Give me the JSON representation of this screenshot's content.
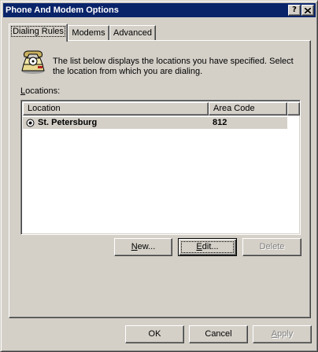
{
  "window": {
    "title": "Phone And Modem Options"
  },
  "title_buttons": {
    "help": "?",
    "close": "X"
  },
  "tabs": [
    {
      "label": "Dialing Rules",
      "active": true
    },
    {
      "label": "Modems",
      "active": false
    },
    {
      "label": "Advanced",
      "active": false
    }
  ],
  "dialing_rules": {
    "icon": "telephone-icon",
    "description": "The list below displays the locations you have specified. Select the location from which you are dialing.",
    "locations_label": "Locations:",
    "columns": [
      "Location",
      "Area Code"
    ],
    "rows": [
      {
        "location": "St. Petersburg",
        "area_code": "812",
        "selected": true
      }
    ],
    "buttons": {
      "new": "New...",
      "edit": "Edit...",
      "delete": "Delete"
    }
  },
  "dialog_buttons": {
    "ok": "OK",
    "cancel": "Cancel",
    "apply": "Apply"
  },
  "colors": {
    "titlebar": "#0a246a",
    "face": "#d4d0c8",
    "shadow": "#808080",
    "highlight": "#ffffff"
  }
}
